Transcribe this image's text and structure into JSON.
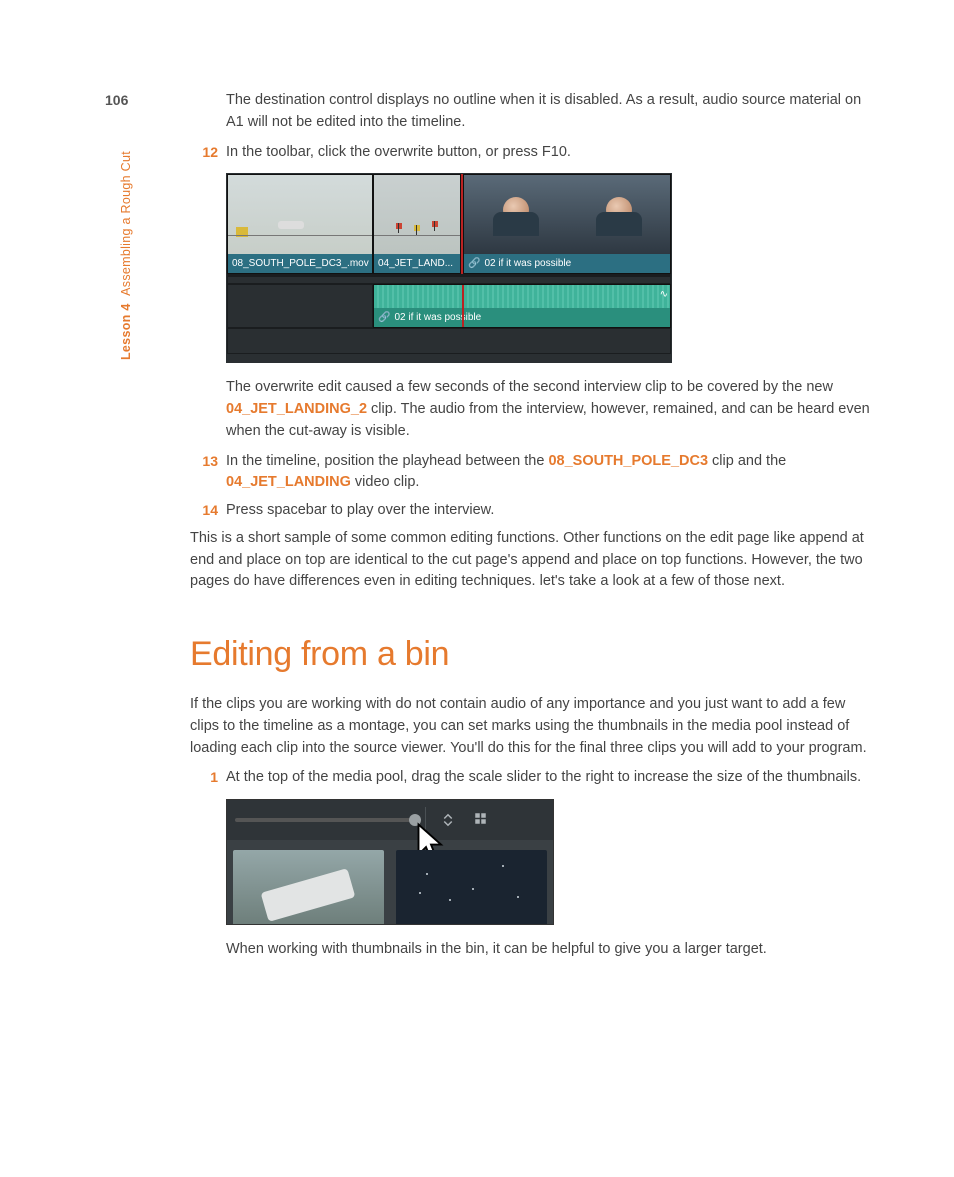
{
  "page_number": "106",
  "side": {
    "lesson": "Lesson 4",
    "title": "Assembling a Rough Cut"
  },
  "intro": "The destination control displays no outline when it is disabled. As a result, audio source material on A1 will not be edited into the timeline.",
  "steps_a": [
    {
      "n": "12",
      "text": "In the toolbar, click the overwrite button, or press F10."
    }
  ],
  "fig1": {
    "c1": "08_SOUTH_POLE_DC3_.mov",
    "c2": "04_JET_LAND...",
    "c3_link": "02 if it was possible",
    "a_link": "02 if it was possible",
    "link_icon": "🔗"
  },
  "para_after_fig1_a": "The overwrite edit caused a few seconds of the second interview clip to be covered by the new ",
  "para_after_fig1_hl": "04_JET_LANDING_2",
  "para_after_fig1_b": " clip. The audio from the interview, however, remained, and can be heard even when the cut-away is visible.",
  "steps_b": [
    {
      "n": "13",
      "pre": "In the timeline, position the playhead between the ",
      "h1": "08_SOUTH_POLE_DC3",
      "mid": " clip and the ",
      "h2": "04_JET_LANDING",
      "post": " video clip."
    },
    {
      "n": "14",
      "text": "Press spacebar to play over the interview."
    }
  ],
  "summary": "This is a short sample of some common editing functions. Other functions on the edit page like append at end and place on top are identical to the cut page's append and place on top functions. However, the two pages do have differences even in editing techniques. let's take a look at a few of those next.",
  "heading": "Editing from a bin",
  "bin_intro": "If the clips you are working with do not contain audio of any importance and you just want to add a few clips to the timeline as a montage, you can set marks using the thumbnails in the media pool instead of loading each clip into the source viewer. You'll do this for the final three clips you will add to your program.",
  "steps_c": [
    {
      "n": "1",
      "text": "At the top of the media pool, drag the scale slider to the right to increase the size of the thumbnails."
    }
  ],
  "caption2": "When working with thumbnails in the bin, it can be helpful to give you a larger target."
}
